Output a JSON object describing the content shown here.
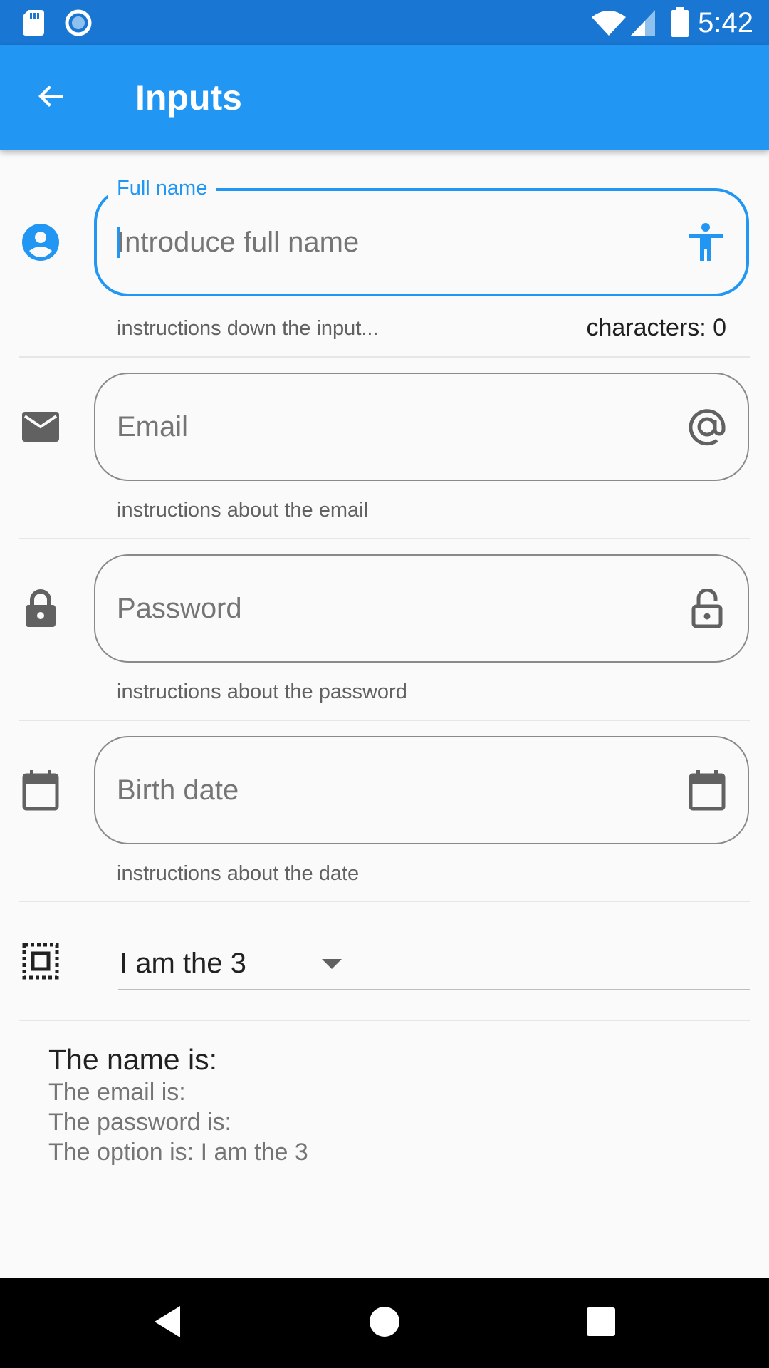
{
  "status_bar": {
    "time": "5:42"
  },
  "app_bar": {
    "title": "Inputs"
  },
  "form": {
    "full_name": {
      "label": "Full name",
      "placeholder": "Introduce full name",
      "helper": "instructions down the input...",
      "counter": "characters: 0"
    },
    "email": {
      "placeholder": "Email",
      "helper": "instructions about the email"
    },
    "password": {
      "placeholder": "Password",
      "helper": "instructions about the password"
    },
    "birth_date": {
      "placeholder": "Birth date",
      "helper": "instructions about the date"
    },
    "option": {
      "selected": "I am the 3"
    }
  },
  "summary": {
    "name_line": "The name is:",
    "email_line": "The email is:",
    "password_line": "The password is:",
    "option_line": "The option is: I am the 3"
  },
  "colors": {
    "status_bar": "#1976d2",
    "app_bar": "#2196f3",
    "accent": "#2196f3",
    "icon_grey": "#616161"
  },
  "icons": {
    "status": [
      "sd-card-icon",
      "sync-circle-icon",
      "wifi-icon",
      "cell-signal-icon",
      "battery-icon"
    ],
    "fields": [
      "account-circle-icon",
      "accessibility-icon",
      "mail-icon",
      "at-sign-icon",
      "lock-icon",
      "lock-open-icon",
      "calendar-icon",
      "select-all-icon"
    ],
    "nav": [
      "back-triangle-icon",
      "home-circle-icon",
      "recents-square-icon"
    ]
  }
}
